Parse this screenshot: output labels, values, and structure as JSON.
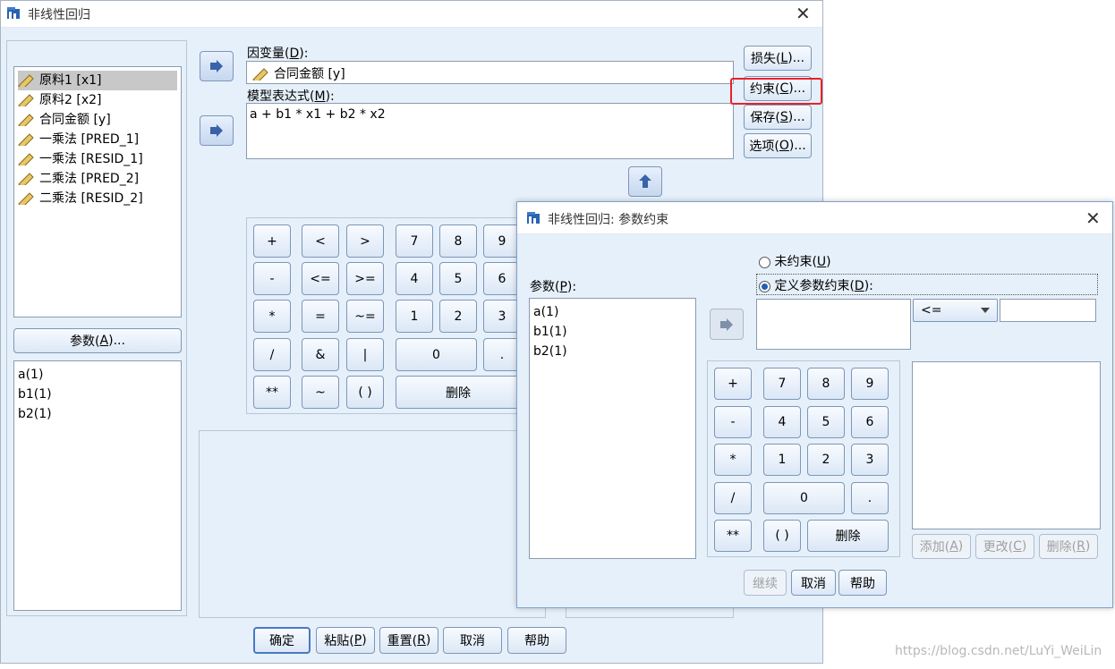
{
  "main": {
    "title": "非线性回归",
    "close_icon": "close-icon",
    "variables": [
      {
        "label": "原料1 [x1]",
        "icon": "ruler-icon",
        "selected": true
      },
      {
        "label": "原料2 [x2]",
        "icon": "ruler-icon"
      },
      {
        "label": "合同金额 [y]",
        "icon": "ruler-icon"
      },
      {
        "label": "一乘法 [PRED_1]",
        "icon": "ruler-icon"
      },
      {
        "label": "一乘法 [RESID_1]",
        "icon": "ruler-icon"
      },
      {
        "label": "二乘法 [PRED_2]",
        "icon": "ruler-icon"
      },
      {
        "label": "二乘法 [RESID_2]",
        "icon": "ruler-icon"
      }
    ],
    "params_button": {
      "text": "参数(",
      "key": "A",
      "tail": ")..."
    },
    "params": [
      "a(1)",
      "b1(1)",
      "b2(1)"
    ],
    "dependent": {
      "label_text": "因变量(",
      "key": "D",
      "tail": "):",
      "value": "合同金额 [y]"
    },
    "model_expr": {
      "label_text": "模型表达式(",
      "key": "M",
      "tail": "):",
      "value": "a + b1 * x1 + b2 * x2"
    },
    "side_buttons": [
      {
        "text": "损失(",
        "key": "L",
        "tail": ")..."
      },
      {
        "text": "约束(",
        "key": "C",
        "tail": ")..."
      },
      {
        "text": "保存(",
        "key": "S",
        "tail": ")..."
      },
      {
        "text": "选项(",
        "key": "O",
        "tail": ")..."
      }
    ],
    "keypad": [
      "+",
      "<",
      ">",
      "7",
      "8",
      "9",
      "-",
      "<=",
      ">=",
      "4",
      "5",
      "6",
      "*",
      "=",
      "~=",
      "1",
      "2",
      "3",
      "/",
      "&",
      "|",
      "0",
      ".",
      "**",
      "~",
      "( )",
      "删除"
    ],
    "bottom_buttons": [
      {
        "text": "确定",
        "key": "",
        "tail": ""
      },
      {
        "text": "粘贴(",
        "key": "P",
        "tail": ")"
      },
      {
        "text": "重置(",
        "key": "R",
        "tail": ")"
      },
      {
        "text": "取消",
        "key": "",
        "tail": ""
      },
      {
        "text": "帮助",
        "key": "",
        "tail": ""
      }
    ],
    "highlight_color": "#e8212b"
  },
  "dialog": {
    "title": "非线性回归: 参数约束",
    "close_icon": "close-icon",
    "params_label": {
      "text": "参数(",
      "key": "P",
      "tail": "):"
    },
    "params": [
      "a(1)",
      "b1(1)",
      "b2(1)"
    ],
    "radio_unconstrained": {
      "text": "未约束(",
      "key": "U",
      "tail": ")",
      "checked": false
    },
    "radio_define": {
      "text": "定义参数约束(",
      "key": "D",
      "tail": "):",
      "checked": true
    },
    "operator_select": "<=",
    "keypad": [
      "+",
      "7",
      "8",
      "9",
      "-",
      "4",
      "5",
      "6",
      "*",
      "1",
      "2",
      "3",
      "/",
      "0",
      ".",
      "**",
      "( )",
      "删除"
    ],
    "list_buttons": [
      {
        "text": "添加(",
        "key": "A",
        "tail": ")"
      },
      {
        "text": "更改(",
        "key": "C",
        "tail": ")"
      },
      {
        "text": "删除(",
        "key": "R",
        "tail": ")"
      }
    ],
    "bottom_buttons": [
      {
        "text": "继续"
      },
      {
        "text": "取消"
      },
      {
        "text": "帮助"
      }
    ]
  },
  "watermark": "https://blog.csdn.net/LuYi_WeiLin"
}
